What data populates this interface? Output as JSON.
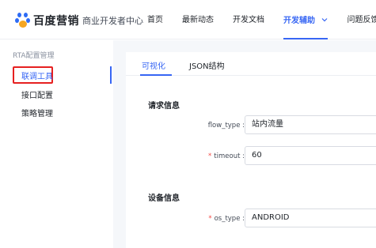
{
  "header": {
    "brand": "百度营销",
    "subtitle": "商业开发者中心",
    "nav": [
      {
        "label": "首页"
      },
      {
        "label": "最新动态"
      },
      {
        "label": "开发文档"
      },
      {
        "label": "开发辅助"
      },
      {
        "label": "问题反馈"
      }
    ],
    "active_nav_index": 3
  },
  "sidebar": {
    "group_title": "RTA配置管理",
    "items": [
      {
        "label": "联调工具"
      },
      {
        "label": "接口配置"
      },
      {
        "label": "策略管理"
      }
    ],
    "active_index": 0
  },
  "main": {
    "tabs": [
      {
        "label": "可视化"
      },
      {
        "label": "JSON结构"
      }
    ],
    "active_tab_index": 0,
    "sections": [
      {
        "title": "请求信息",
        "fields": [
          {
            "label": "flow_type :",
            "value": "站内流量",
            "required": false
          },
          {
            "label": "timeout :",
            "value": "60",
            "required": true
          }
        ]
      },
      {
        "title": "设备信息",
        "fields": [
          {
            "label": "os_type :",
            "value": "ANDROID",
            "required": true
          }
        ]
      }
    ],
    "required_marker": "*"
  },
  "colors": {
    "accent": "#3766f4",
    "highlight_box": "#e62020",
    "required": "#f54a45",
    "main_background": "#f5f7fa"
  },
  "icons": {
    "logo": "baidu-paw-icon",
    "nav_dropdown": "chevron-down-icon"
  }
}
